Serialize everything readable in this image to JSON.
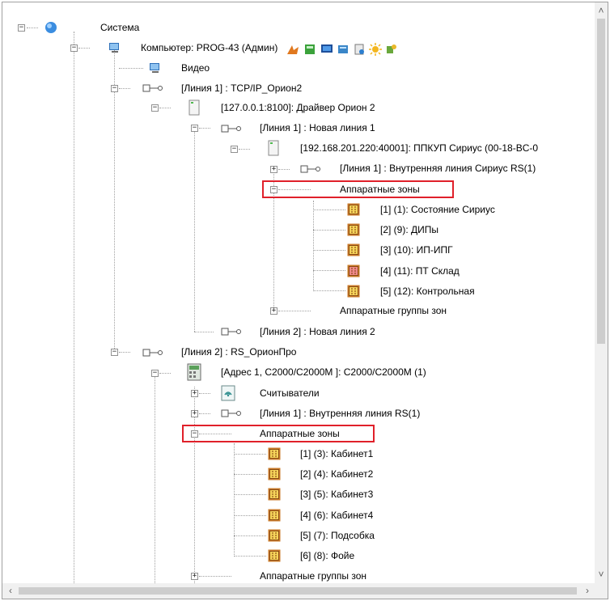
{
  "tree": {
    "sistema": "Система",
    "computer": "Компьютер: PROG-43 (Админ)",
    "video": "Видео",
    "line1_tcp": "[Линия 1] : TCP/IP_Орион2",
    "driver": "[127.0.0.1:8100]: Драйвер Орион 2",
    "line1_new": "[Линия 1] : Новая линия 1",
    "ppkup": "[192.168.201.220:40001]: ППКУП Сириус (00-18-BC-0",
    "line1_inner_sirius": "[Линия 1] : Внутренняя линия Сириус RS(1)",
    "hw_zones_1": "Аппаратные зоны",
    "zones1": [
      "[1] (1): Состояние Сириус",
      "[2] (9): ДИПы",
      "[3] (10): ИП-ИПГ",
      "[4] (11): ПТ Склад",
      "[5] (12): Контрольная"
    ],
    "hw_groups_1": "Аппаратные группы зон",
    "line2_new": "[Линия 2] : Новая линия 2",
    "line2_rs": "[Линия 2] : RS_ОрионПро",
    "c2000": "[Адрес 1, С2000/С2000М ]: С2000/С2000М (1)",
    "readers": "Считыватели",
    "line1_inner_rs": "[Линия 1] : Внутренняя линия RS(1)",
    "hw_zones_2": "Аппаратные зоны",
    "zones2": [
      "[1] (3): Кабинет1",
      "[2] (4): Кабинет2",
      "[3] (5): Кабинет3",
      "[4] (6): Кабинет4",
      "[5] (7): Подсобка",
      "[6] (8): Фойе"
    ],
    "hw_groups_2": "Аппаратные группы зон"
  },
  "colors": {
    "highlight": "#e0202a",
    "zone_normal": "#f5d35a",
    "zone_alarm": "#f08a8a"
  },
  "icons": {
    "system": "globe-icon",
    "computer": "computer-icon",
    "device": "device-icon",
    "line": "line-connector-icon",
    "zone": "zone-icon",
    "readers": "reader-icon",
    "c2000": "controller-icon"
  }
}
